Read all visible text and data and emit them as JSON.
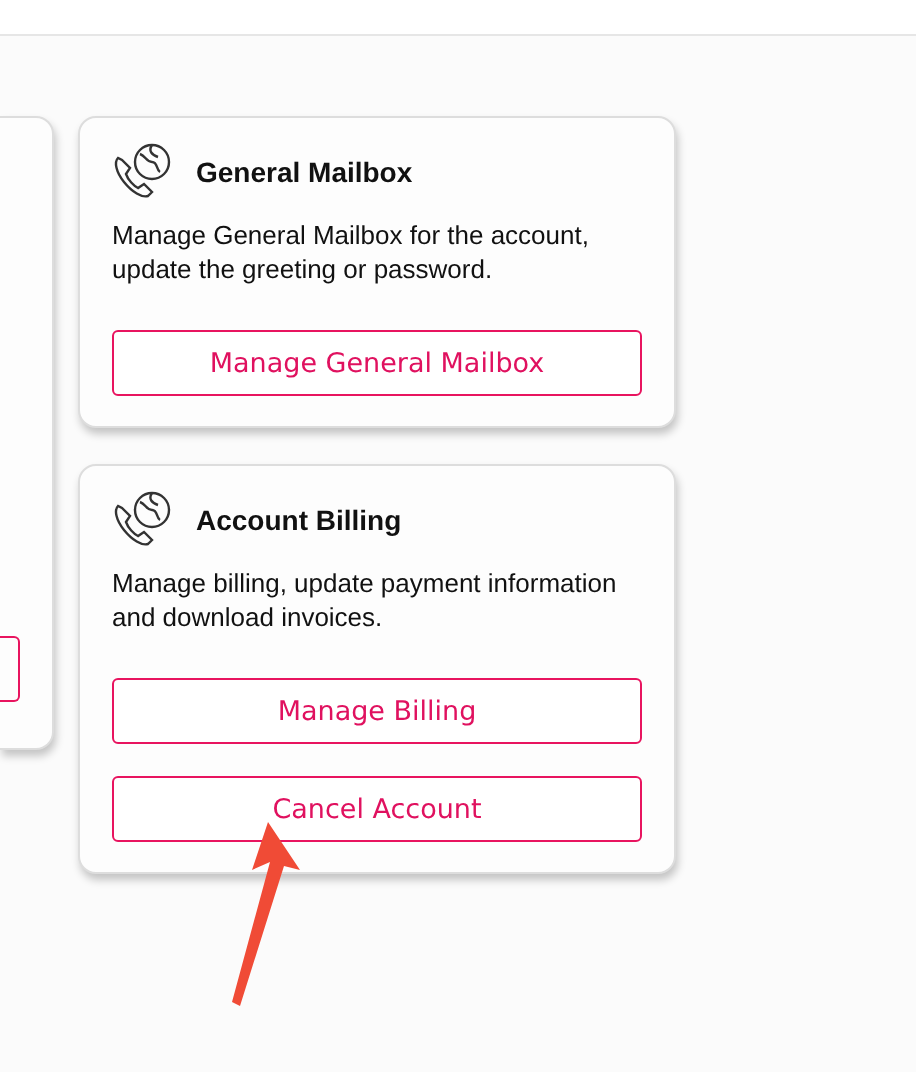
{
  "cards": [
    {
      "title": "General Mailbox",
      "description": "Manage General Mailbox for the account, update the greeting or password.",
      "buttons": [
        "Manage General Mailbox"
      ]
    },
    {
      "title": "Account Billing",
      "description": "Manage billing, update payment information and download invoices.",
      "buttons": [
        "Manage Billing",
        "Cancel Account"
      ]
    }
  ]
}
